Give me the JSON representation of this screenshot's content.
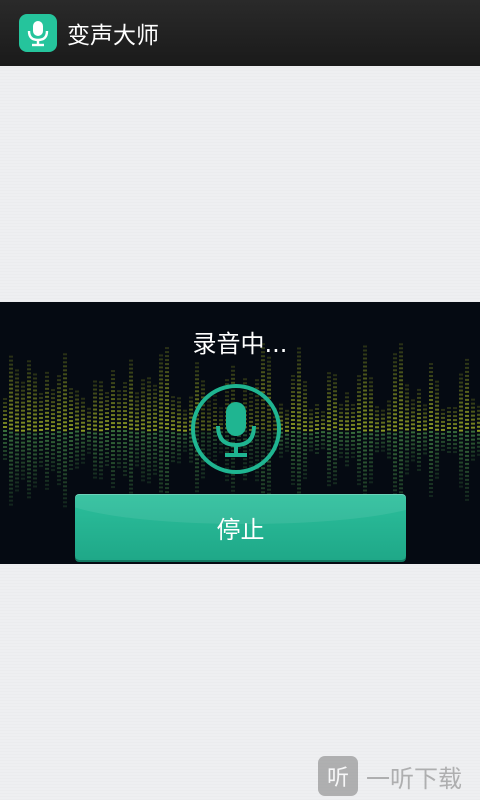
{
  "app": {
    "title": "变声大师",
    "icon": "microphone-icon",
    "accent_color": "#25c49c"
  },
  "recorder": {
    "status": "录音中...",
    "mic_icon": "microphone-icon",
    "stop_label": "停止"
  },
  "watermark": {
    "badge": "听",
    "text": "一听下载"
  }
}
